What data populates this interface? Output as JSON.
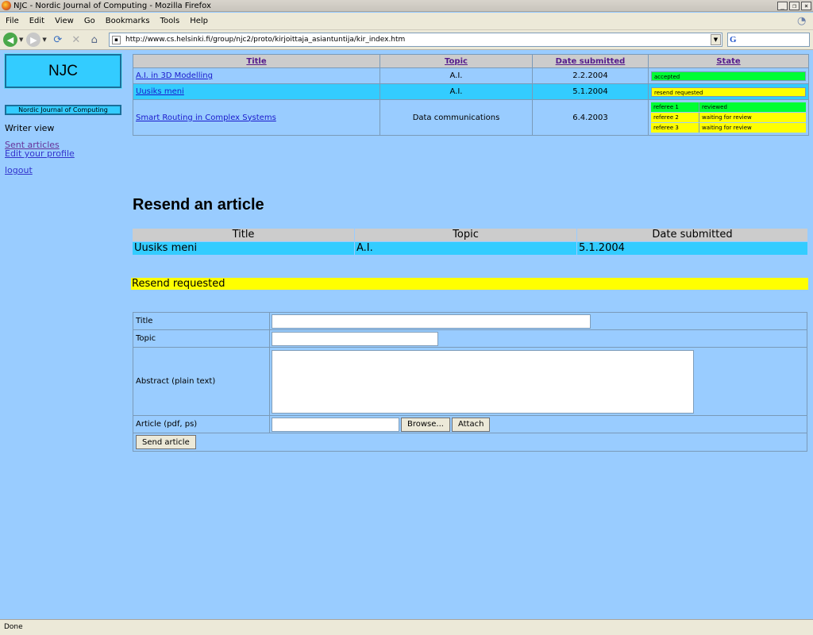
{
  "window": {
    "title": "NJC - Nordic Journal of Computing - Mozilla Firefox"
  },
  "menu": [
    "File",
    "Edit",
    "View",
    "Go",
    "Bookmarks",
    "Tools",
    "Help"
  ],
  "address": {
    "url": "http://www.cs.helsinki.fi/group/njc2/proto/kirjoittaja_asiantuntija/kir_index.htm"
  },
  "search": {
    "engine_icon": "G"
  },
  "sidebar": {
    "logo": "NJC",
    "journal_name": "Nordic Journal of Computing",
    "view_label": "Writer view",
    "links": {
      "sent_articles": "Sent articles",
      "edit_profile": "Edit your profile",
      "logout": "logout"
    }
  },
  "articles": {
    "headers": {
      "title": "Title",
      "topic": "Topic",
      "date": "Date submitted",
      "state": "State"
    },
    "rows": [
      {
        "title": "A.I. in 3D Modelling",
        "topic": "A.I.",
        "date": "2.2.2004",
        "state": "accepted"
      },
      {
        "title": "Uusiks meni",
        "topic": "A.I.",
        "date": "5.1.2004",
        "state": "resend requested"
      },
      {
        "title": "Smart Routing in Complex Systems",
        "topic": "Data communications",
        "date": "6.4.2003",
        "referees": [
          {
            "name": "referee 1",
            "status": "reviewed"
          },
          {
            "name": "referee 2",
            "status": "waiting for review"
          },
          {
            "name": "referee 3",
            "status": "waiting for review"
          }
        ]
      }
    ]
  },
  "resend": {
    "heading": "Resend an article",
    "headers": {
      "title": "Title",
      "topic": "Topic",
      "date": "Date submitted"
    },
    "row": {
      "title": "Uusiks meni",
      "topic": "A.I.",
      "date": "5.1.2004"
    },
    "status": "Resend requested"
  },
  "form": {
    "title_label": "Title",
    "topic_label": "Topic",
    "abstract_label": "Abstract (plain text)",
    "article_label": "Article (pdf, ps)",
    "browse_label": "Browse...",
    "attach_label": "Attach",
    "send_label": "Send article"
  },
  "statusbar": {
    "text": "Done"
  },
  "colors": {
    "page_bg": "#99ccff",
    "highlight": "#33ccff",
    "accepted": "#00ff33",
    "pending": "#ffff00"
  }
}
